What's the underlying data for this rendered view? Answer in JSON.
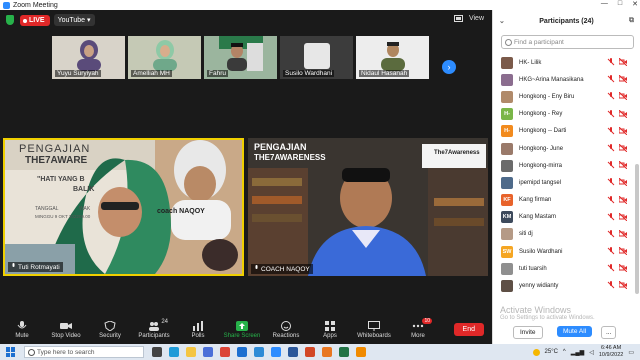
{
  "window": {
    "title": "Zoom Meeting",
    "controls": [
      "—",
      "□",
      "✕"
    ]
  },
  "topbar": {
    "live_label": "LIVE",
    "youtube_label": "YouTube ▾",
    "view_label": "View"
  },
  "thumbnails": [
    {
      "name": "Yuyu Suryiyah",
      "bg": "#d8d3c9",
      "fig": "#5a4b7a"
    },
    {
      "name": "Amelliah MH",
      "bg": "#c5c9b5",
      "fig": "#8ec9a6"
    },
    {
      "name": "Fahru",
      "bg": "#9bb59e",
      "fig": "#3a3a3a"
    },
    {
      "name": "Susilo Wardhani",
      "bg": "#3c3c3c",
      "fig": "#e7e7e7"
    },
    {
      "name": "Nidaul Hasanah",
      "bg": "#ededed",
      "fig": "#5b6b3e"
    }
  ],
  "main_videos": {
    "left": {
      "name": "Tuti Rotmayati",
      "title_line1": "PENGAJIAN",
      "title_line2": "THE7AWARE",
      "quote": "\"HATI YANG B",
      "quote2": "BALIK",
      "coach_text": "coach NAQOY",
      "tanggal": "TANGGAL",
      "tanggal_val": "MINGGU 9 OKT 2022",
      "waktu": "WAK",
      "waktu_val": "09.00"
    },
    "right": {
      "name": "COACH NAQOY",
      "title_line1": "PENGAJIAN",
      "title_line2": "THE7AWARENESS",
      "logo_text": "The7Awareness"
    }
  },
  "toolbar": {
    "items": [
      {
        "key": "mute",
        "label": "Mute",
        "icon": "mic-icon"
      },
      {
        "key": "stop_video",
        "label": "Stop Video",
        "icon": "video-camera-icon"
      },
      {
        "key": "security",
        "label": "Security",
        "icon": "shield-icon"
      },
      {
        "key": "participants",
        "label": "Participants",
        "icon": "people-icon",
        "count": "24"
      },
      {
        "key": "polls",
        "label": "Polls",
        "icon": "poll-icon"
      },
      {
        "key": "share_screen",
        "label": "Share Screen",
        "icon": "share-screen-icon"
      },
      {
        "key": "reactions",
        "label": "Reactions",
        "icon": "smiley-icon"
      },
      {
        "key": "apps",
        "label": "Apps",
        "icon": "apps-icon"
      },
      {
        "key": "whiteboards",
        "label": "Whiteboards",
        "icon": "whiteboard-icon"
      },
      {
        "key": "more",
        "label": "More",
        "icon": "ellipsis-icon",
        "badge": "10"
      }
    ],
    "end_label": "End"
  },
  "participants_panel": {
    "title": "Participants (24)",
    "search_placeholder": "Find a participant",
    "participants": [
      {
        "name": "HK- Lilik",
        "avatar": "photo",
        "color": "#7b5a4a"
      },
      {
        "name": "HKG~Arina Manasikana",
        "avatar": "photo",
        "color": "#8b6d8f"
      },
      {
        "name": "Hongkong - Eny Biru",
        "avatar": "photo",
        "color": "#b08a6a"
      },
      {
        "name": "Hongkong - Rey",
        "avatar": "initial",
        "initial": "H-",
        "color": "#7ab648"
      },
      {
        "name": "Hongkong -- Darti",
        "avatar": "initial",
        "initial": "H-",
        "color": "#f28b1e"
      },
      {
        "name": "Hongkong- June",
        "avatar": "photo",
        "color": "#9a7a6a"
      },
      {
        "name": "Hongkong-mirra",
        "avatar": "photo",
        "color": "#6b6b6b"
      },
      {
        "name": "ipemipd tangsel",
        "avatar": "photo",
        "color": "#4e6a8a"
      },
      {
        "name": "Kang firman",
        "avatar": "initial",
        "initial": "KF",
        "color": "#e8632b"
      },
      {
        "name": "Kang Mastam",
        "avatar": "initial",
        "initial": "KM",
        "color": "#3d4a5c"
      },
      {
        "name": "siti dj",
        "avatar": "photo",
        "color": "#b59a86"
      },
      {
        "name": "Susilo Wardhani",
        "avatar": "initial",
        "initial": "SW",
        "color": "#f5a623"
      },
      {
        "name": "tuti tuarsih",
        "avatar": "photo",
        "color": "#8f8f8f"
      },
      {
        "name": "yenny widianty",
        "avatar": "photo",
        "color": "#5e4f45"
      }
    ],
    "invite_label": "Invite",
    "mute_all_label": "Mute All",
    "more_label": "..."
  },
  "watermark": {
    "line1": "Activate Windows",
    "line2": "Go to Settings to activate Windows."
  },
  "taskbar": {
    "search_placeholder": "Type here to search",
    "temperature": "25°C",
    "time": "6:46 AM",
    "date": "10/9/2022",
    "apps": [
      {
        "name": "task-view-icon",
        "color": "#444"
      },
      {
        "name": "edge-icon",
        "color": "#1f9bd8"
      },
      {
        "name": "file-explorer-icon",
        "color": "#f4c542"
      },
      {
        "name": "store-icon",
        "color": "#4a6fd8"
      },
      {
        "name": "chrome-icon",
        "color": "#db4437"
      },
      {
        "name": "mail-icon",
        "color": "#1c6fd0"
      },
      {
        "name": "photos-icon",
        "color": "#2e8bd6"
      },
      {
        "name": "zoom-icon",
        "color": "#2d8cff"
      },
      {
        "name": "word-icon",
        "color": "#2b579a"
      },
      {
        "name": "powerpoint-icon",
        "color": "#d24726"
      },
      {
        "name": "media-icon",
        "color": "#e87722"
      },
      {
        "name": "excel-icon",
        "color": "#217346"
      },
      {
        "name": "vlc-icon",
        "color": "#f08a00"
      }
    ]
  },
  "colors": {
    "accent": "#2d8cff",
    "live": "#e02828",
    "end": "#e02828",
    "speaker_border": "#f0d000",
    "share_green": "#27b24a"
  }
}
